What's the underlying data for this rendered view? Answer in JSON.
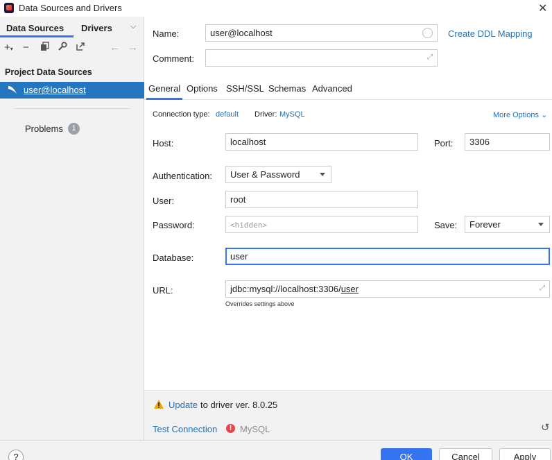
{
  "window": {
    "title": "Data Sources and Drivers"
  },
  "left_panel": {
    "tabs": [
      {
        "label": "Data Sources"
      },
      {
        "label": "Drivers"
      }
    ],
    "section_title": "Project Data Sources",
    "data_sources": [
      {
        "label": "user@localhost"
      }
    ],
    "problems": {
      "label": "Problems",
      "count": "1"
    }
  },
  "form": {
    "name_label": "Name:",
    "name_value": "user@localhost",
    "create_ddl_link": "Create DDL Mapping",
    "comment_label": "Comment:",
    "comment_value": ""
  },
  "tabs": [
    {
      "label": "General"
    },
    {
      "label": "Options"
    },
    {
      "label": "SSH/SSL"
    },
    {
      "label": "Schemas"
    },
    {
      "label": "Advanced"
    }
  ],
  "general": {
    "connection_type_label": "Connection type:",
    "connection_type_value": "default",
    "driver_label": "Driver:",
    "driver_value": "MySQL",
    "more_options": "More Options",
    "host_label": "Host:",
    "host_value": "localhost",
    "port_label": "Port:",
    "port_value": "3306",
    "auth_label": "Authentication:",
    "auth_value": "User & Password",
    "user_label": "User:",
    "user_value": "root",
    "password_label": "Password:",
    "password_placeholder": "<hidden>",
    "save_label": "Save:",
    "save_value": "Forever",
    "database_label": "Database:",
    "database_value": "user",
    "url_label": "URL:",
    "url_prefix": "jdbc:mysql://localhost:3306/",
    "url_db": "user",
    "url_note": "Overrides settings above"
  },
  "footer": {
    "update_link": "Update",
    "update_text": "to driver ver. 8.0.25",
    "test_connection": "Test Connection",
    "test_driver": "MySQL"
  },
  "buttons": {
    "help": "?",
    "ok": "OK",
    "cancel": "Cancel",
    "apply": "Apply"
  },
  "colors": {
    "accent": "#3574f0",
    "selection": "#2675bf",
    "link": "#2470b3",
    "warning": "#f0a30a",
    "error": "#e5484d"
  }
}
